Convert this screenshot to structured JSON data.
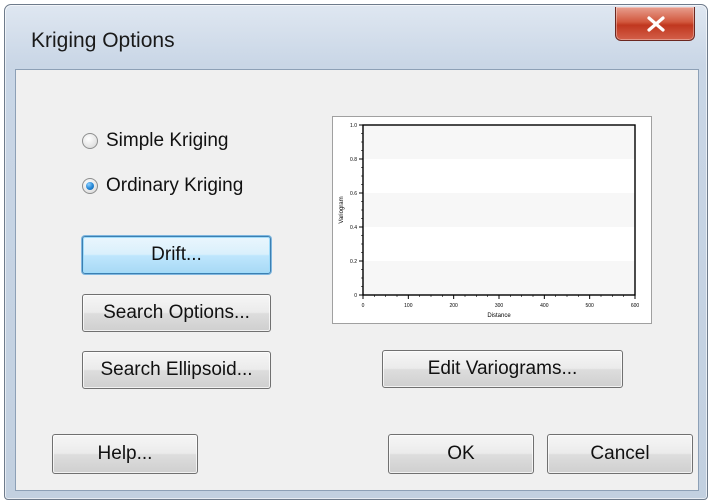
{
  "window": {
    "title": "Kriging Options",
    "close_icon": "close-x-icon"
  },
  "options": {
    "simple_kriging": {
      "label": "Simple Kriging",
      "checked": false
    },
    "ordinary_kriging": {
      "label": "Ordinary Kriging",
      "checked": true
    }
  },
  "buttons": {
    "drift": "Drift...",
    "search_options": "Search Options...",
    "search_ellipsoid": "Search Ellipsoid...",
    "edit_variograms": "Edit Variograms...",
    "help": "Help...",
    "ok": "OK",
    "cancel": "Cancel"
  },
  "chart_data": {
    "type": "line",
    "title": "",
    "xlabel": "Distance",
    "ylabel": "Variogram",
    "xlim": [
      0,
      600
    ],
    "ylim": [
      0,
      1.0
    ],
    "x_ticks": [
      "0",
      "100",
      "200",
      "300",
      "400",
      "500",
      "600"
    ],
    "y_ticks": [
      "0",
      "0.2",
      "0.4",
      "0.6",
      "0.8",
      "1.0"
    ],
    "series": []
  },
  "colors": {
    "radio_selected": "#2a8bd8",
    "focused_button": "#bee6fd",
    "close_button": "#c0371f"
  }
}
